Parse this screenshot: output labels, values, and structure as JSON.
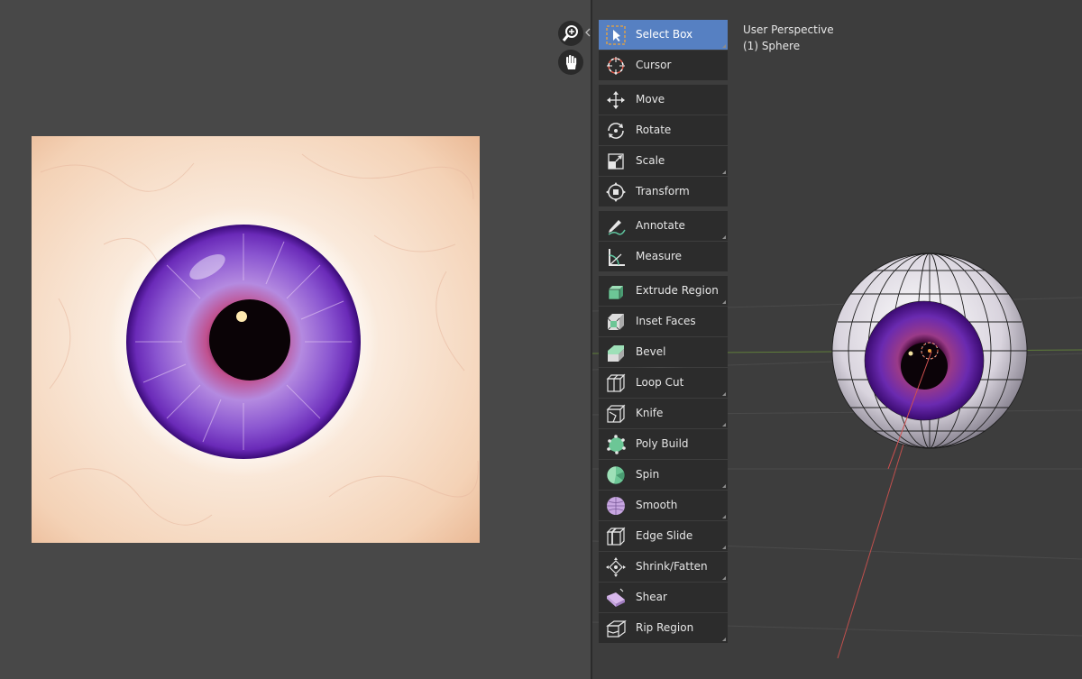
{
  "viewport": {
    "view_name": "User Perspective",
    "object_label": "(1) Sphere"
  },
  "navigation": {
    "zoom_icon": "zoom-in-icon",
    "pan_icon": "hand-pan-icon"
  },
  "colors": {
    "active_tool_bg": "#5680c2",
    "tool_bg": "#2c2c2c",
    "mesh_tool_icon": "#7fd0a0",
    "deform_tool_icon": "#c7a6e0",
    "axis_x": "#c0504d",
    "axis_y": "#6b8e23"
  },
  "toolbar": {
    "tools": [
      {
        "label": "Select Box",
        "icon": "select-box-icon",
        "active": true
      },
      {
        "label": "Cursor",
        "icon": "cursor-icon"
      },
      {
        "label": "Move",
        "icon": "move-icon"
      },
      {
        "label": "Rotate",
        "icon": "rotate-icon"
      },
      {
        "label": "Scale",
        "icon": "scale-icon"
      },
      {
        "label": "Transform",
        "icon": "transform-icon"
      },
      {
        "label": "Annotate",
        "icon": "annotate-icon"
      },
      {
        "label": "Measure",
        "icon": "measure-icon"
      },
      {
        "label": "Extrude Region",
        "icon": "extrude-region-icon"
      },
      {
        "label": "Inset Faces",
        "icon": "inset-faces-icon"
      },
      {
        "label": "Bevel",
        "icon": "bevel-icon"
      },
      {
        "label": "Loop Cut",
        "icon": "loop-cut-icon"
      },
      {
        "label": "Knife",
        "icon": "knife-icon"
      },
      {
        "label": "Poly Build",
        "icon": "poly-build-icon"
      },
      {
        "label": "Spin",
        "icon": "spin-icon"
      },
      {
        "label": "Smooth",
        "icon": "smooth-icon"
      },
      {
        "label": "Edge Slide",
        "icon": "edge-slide-icon"
      },
      {
        "label": "Shrink/Fatten",
        "icon": "shrink-fatten-icon"
      },
      {
        "label": "Shear",
        "icon": "shear-icon"
      },
      {
        "label": "Rip Region",
        "icon": "rip-region-icon"
      }
    ]
  }
}
